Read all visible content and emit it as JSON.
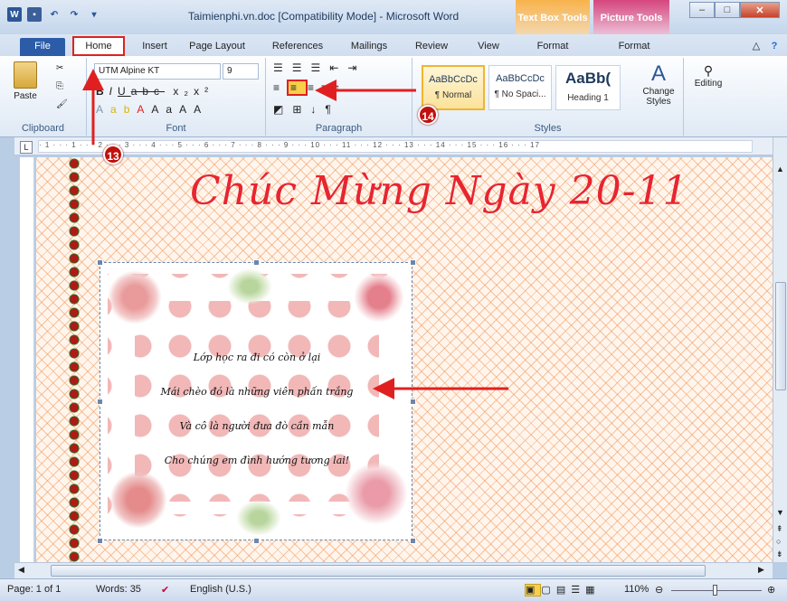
{
  "window": {
    "title": "Taimienphi.vn.doc [Compatibility Mode]  -  Microsoft Word",
    "contextual_tabs": [
      "Text Box Tools",
      "Picture Tools"
    ],
    "controls": [
      "–",
      "□",
      "✕"
    ]
  },
  "tabs": [
    "File",
    "Home",
    "Insert",
    "Page Layout",
    "References",
    "Mailings",
    "Review",
    "View",
    "Format",
    "Format"
  ],
  "ribbon": {
    "clipboard": {
      "paste": "Paste",
      "label": "Clipboard"
    },
    "font": {
      "name": "UTM Alpine KT",
      "size": "9",
      "label": "Font"
    },
    "paragraph": {
      "label": "Paragraph"
    },
    "styles": {
      "label": "Styles",
      "items": [
        {
          "sample": "AaBbCcDc",
          "name": "¶ Normal"
        },
        {
          "sample": "AaBbCcDc",
          "name": "¶ No Spaci..."
        },
        {
          "sample": "AaBb(",
          "name": "Heading 1"
        }
      ],
      "change": "Change Styles"
    },
    "editing": {
      "label": "Editing"
    }
  },
  "document": {
    "heading": "Chúc Mừng Ngày 20-11",
    "poem": [
      "Lớp học ra đi có còn ở lại",
      "Mái chèo đó là những viên phấn trắng",
      "Và cô là người đưa đò cần mẫn",
      "Cho chúng em đình hướng tương lai!"
    ]
  },
  "callouts": {
    "home": "13",
    "center": "14"
  },
  "status": {
    "page": "Page: 1 of 1",
    "words": "Words: 35",
    "language": "English (U.S.)",
    "zoom": "110%"
  },
  "colors": {
    "accent_red": "#e02020",
    "heading_red": "#e8252f",
    "file_tab": "#2c5ca8"
  }
}
